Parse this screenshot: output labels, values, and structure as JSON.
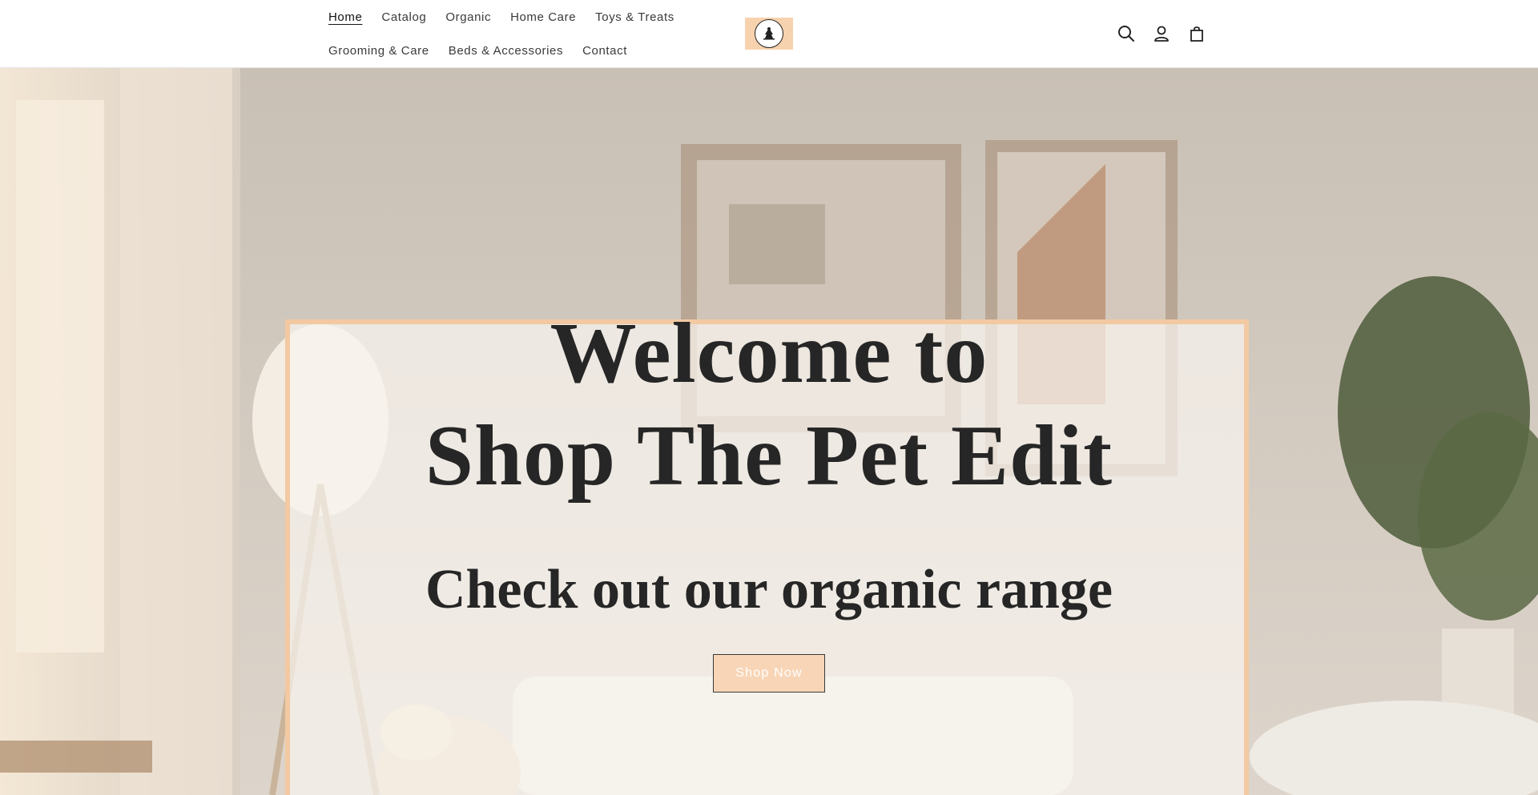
{
  "nav": {
    "row1": [
      "Home",
      "Catalog",
      "Organic",
      "Home Care",
      "Toys & Treats"
    ],
    "row2": [
      "Grooming & Care",
      "Beds & Accessories",
      "Contact"
    ],
    "active": "Home"
  },
  "icons": {
    "search": "search-icon",
    "account": "account-icon",
    "cart": "cart-icon"
  },
  "hero": {
    "title_line1": "Welcome to",
    "title_line2": "Shop The Pet Edit",
    "subtitle": "Check out our organic range",
    "button_label": "Shop Now"
  },
  "colors": {
    "accent": "#f2c9a2",
    "button_bg": "#f8d5b6",
    "text": "#262626"
  }
}
